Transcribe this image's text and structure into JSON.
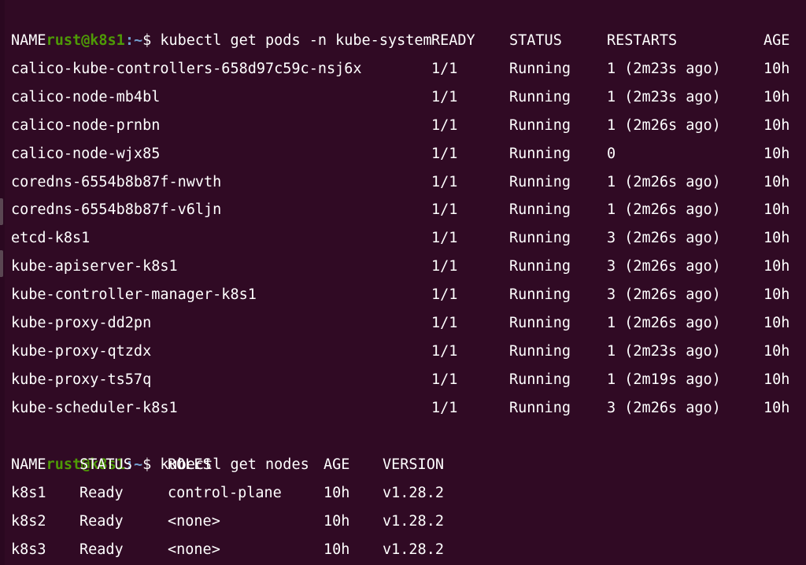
{
  "terminal": {
    "prompt": {
      "user_host": "rust@k8s1",
      "path": ":~",
      "symbol": "$ "
    },
    "colors": {
      "background": "#300a24",
      "text": "#ffffff",
      "prompt_user": "#4e9a06",
      "prompt_path": "#729fcf"
    },
    "command1": "kubectl get pods -n kube-system",
    "pods": {
      "headers": [
        "NAME",
        "READY",
        "STATUS",
        "RESTARTS",
        "AGE"
      ],
      "rows": [
        [
          "calico-kube-controllers-658d97c59c-nsj6x",
          "1/1",
          "Running",
          "1 (2m23s ago)",
          "10h"
        ],
        [
          "calico-node-mb4bl",
          "1/1",
          "Running",
          "1 (2m23s ago)",
          "10h"
        ],
        [
          "calico-node-prnbn",
          "1/1",
          "Running",
          "1 (2m26s ago)",
          "10h"
        ],
        [
          "calico-node-wjx85",
          "1/1",
          "Running",
          "0",
          "10h"
        ],
        [
          "coredns-6554b8b87f-nwvth",
          "1/1",
          "Running",
          "1 (2m26s ago)",
          "10h"
        ],
        [
          "coredns-6554b8b87f-v6ljn",
          "1/1",
          "Running",
          "1 (2m26s ago)",
          "10h"
        ],
        [
          "etcd-k8s1",
          "1/1",
          "Running",
          "3 (2m26s ago)",
          "10h"
        ],
        [
          "kube-apiserver-k8s1",
          "1/1",
          "Running",
          "3 (2m26s ago)",
          "10h"
        ],
        [
          "kube-controller-manager-k8s1",
          "1/1",
          "Running",
          "3 (2m26s ago)",
          "10h"
        ],
        [
          "kube-proxy-dd2pn",
          "1/1",
          "Running",
          "1 (2m26s ago)",
          "10h"
        ],
        [
          "kube-proxy-qtzdx",
          "1/1",
          "Running",
          "1 (2m23s ago)",
          "10h"
        ],
        [
          "kube-proxy-ts57q",
          "1/1",
          "Running",
          "1 (2m19s ago)",
          "10h"
        ],
        [
          "kube-scheduler-k8s1",
          "1/1",
          "Running",
          "3 (2m26s ago)",
          "10h"
        ]
      ]
    },
    "command2": "kubectl get nodes",
    "nodes": {
      "headers": [
        "NAME",
        "STATUS",
        "ROLES",
        "AGE",
        "VERSION"
      ],
      "rows": [
        [
          "k8s1",
          "Ready",
          "control-plane",
          "10h",
          "v1.28.2"
        ],
        [
          "k8s2",
          "Ready",
          "<none>",
          "10h",
          "v1.28.2"
        ],
        [
          "k8s3",
          "Ready",
          "<none>",
          "10h",
          "v1.28.2"
        ]
      ]
    }
  }
}
